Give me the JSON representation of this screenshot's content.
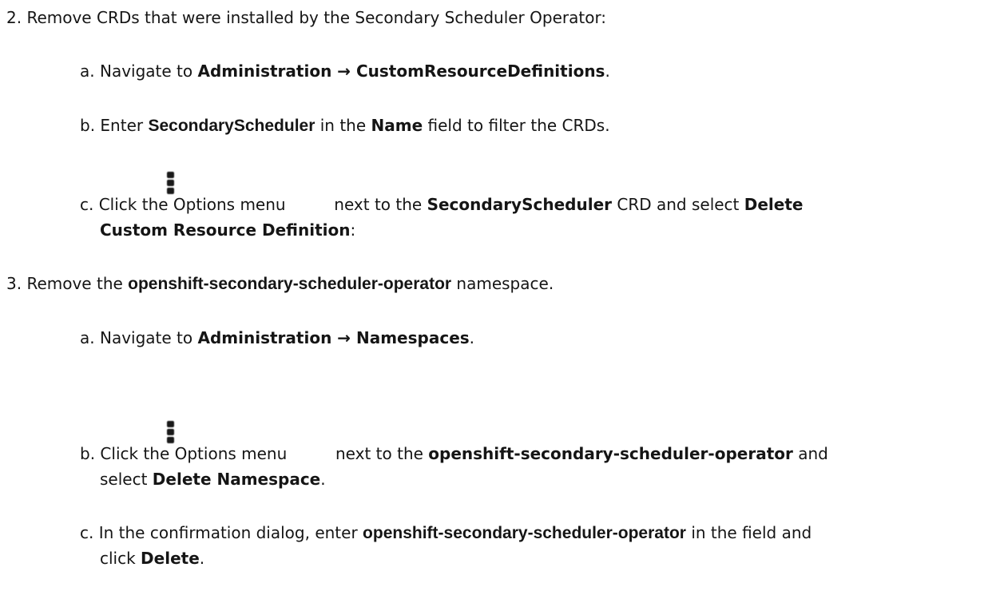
{
  "steps": [
    {
      "marker": "2.",
      "text": "Remove CRDs that were installed by the Secondary Scheduler Operator:",
      "substeps": [
        {
          "marker": "a.",
          "pre": "Navigate to",
          "ui_path": "Administration → CustomResourceDefinitions",
          "post": "."
        },
        {
          "marker": "b.",
          "pre": "Enter",
          "strong": "SecondaryScheduler",
          "mid": "in the",
          "ui": "Name",
          "post": "field to filter the CRDs."
        },
        {
          "marker": "c.",
          "pre": "Click the Options menu",
          "icon": "kebab-menu-icon",
          "mid1": "next to the",
          "ui1": "SecondaryScheduler",
          "mid2": "CRD and select",
          "ui2_line1": "Delete",
          "ui2_line2": "Custom Resource Definition",
          "post": ":"
        }
      ]
    },
    {
      "marker": "3.",
      "pre": "Remove the",
      "strong": "openshift-secondary-scheduler-operator",
      "post": "namespace.",
      "substeps": [
        {
          "marker": "a.",
          "pre": "Navigate to",
          "ui_path": "Administration → Namespaces",
          "post": "."
        },
        {
          "marker": "b.",
          "pre": "Click the Options menu",
          "icon": "kebab-menu-icon",
          "mid": "next to the",
          "ui1": "openshift-secondary-scheduler-operator",
          "post1": "and",
          "line2_pre": "select",
          "ui2": "Delete Namespace",
          "post2": "."
        },
        {
          "marker": "c.",
          "pre": "In the confirmation dialog, enter",
          "strong": "openshift-secondary-scheduler-operator",
          "post1": "in the field and",
          "line2_pre": "click",
          "ui2": "Delete",
          "post2": "."
        }
      ]
    }
  ]
}
